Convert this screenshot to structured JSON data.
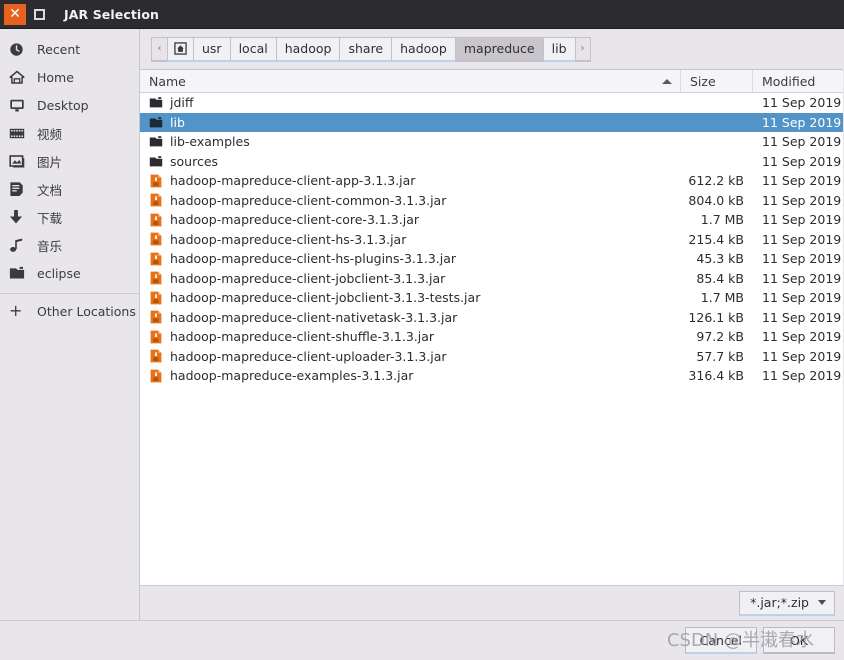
{
  "window": {
    "title": "JAR Selection",
    "close_label": "✕",
    "maximize_label": ""
  },
  "sidebar": {
    "items": [
      {
        "label": "Recent",
        "icon": "clock-icon"
      },
      {
        "label": "Home",
        "icon": "home-icon"
      },
      {
        "label": "Desktop",
        "icon": "desktop-icon"
      },
      {
        "label": "视频",
        "icon": "video-icon"
      },
      {
        "label": "图片",
        "icon": "pictures-icon"
      },
      {
        "label": "文档",
        "icon": "documents-icon"
      },
      {
        "label": "下载",
        "icon": "downloads-icon"
      },
      {
        "label": "音乐",
        "icon": "music-icon"
      },
      {
        "label": "eclipse",
        "icon": "folder-icon"
      }
    ],
    "other_locations": {
      "label": "Other Locations",
      "icon": "plus-icon"
    }
  },
  "pathbar": {
    "prev_label": "‹",
    "next_label": "›",
    "crumbs": [
      {
        "label": "",
        "icon": "home-crumb-icon",
        "active": false
      },
      {
        "label": "usr",
        "active": false
      },
      {
        "label": "local",
        "active": false
      },
      {
        "label": "hadoop",
        "active": false
      },
      {
        "label": "share",
        "active": false
      },
      {
        "label": "hadoop",
        "active": false
      },
      {
        "label": "mapreduce",
        "active": true
      },
      {
        "label": "lib",
        "active": false
      }
    ]
  },
  "filelist": {
    "columns": {
      "name": "Name",
      "size": "Size",
      "modified": "Modified"
    },
    "sort": {
      "column": "Name",
      "direction": "asc"
    },
    "rows": [
      {
        "name": "jdiff",
        "type": "folder",
        "size": "",
        "modified": "11 Sep 2019",
        "selected": false
      },
      {
        "name": "lib",
        "type": "folder",
        "size": "",
        "modified": "11 Sep 2019",
        "selected": true
      },
      {
        "name": "lib-examples",
        "type": "folder",
        "size": "",
        "modified": "11 Sep 2019",
        "selected": false
      },
      {
        "name": "sources",
        "type": "folder",
        "size": "",
        "modified": "11 Sep 2019",
        "selected": false
      },
      {
        "name": "hadoop-mapreduce-client-app-3.1.3.jar",
        "type": "jar",
        "size": "612.2 kB",
        "modified": "11 Sep 2019",
        "selected": false
      },
      {
        "name": "hadoop-mapreduce-client-common-3.1.3.jar",
        "type": "jar",
        "size": "804.0 kB",
        "modified": "11 Sep 2019",
        "selected": false
      },
      {
        "name": "hadoop-mapreduce-client-core-3.1.3.jar",
        "type": "jar",
        "size": "1.7 MB",
        "modified": "11 Sep 2019",
        "selected": false
      },
      {
        "name": "hadoop-mapreduce-client-hs-3.1.3.jar",
        "type": "jar",
        "size": "215.4 kB",
        "modified": "11 Sep 2019",
        "selected": false
      },
      {
        "name": "hadoop-mapreduce-client-hs-plugins-3.1.3.jar",
        "type": "jar",
        "size": "45.3 kB",
        "modified": "11 Sep 2019",
        "selected": false
      },
      {
        "name": "hadoop-mapreduce-client-jobclient-3.1.3.jar",
        "type": "jar",
        "size": "85.4 kB",
        "modified": "11 Sep 2019",
        "selected": false
      },
      {
        "name": "hadoop-mapreduce-client-jobclient-3.1.3-tests.jar",
        "type": "jar",
        "size": "1.7 MB",
        "modified": "11 Sep 2019",
        "selected": false
      },
      {
        "name": "hadoop-mapreduce-client-nativetask-3.1.3.jar",
        "type": "jar",
        "size": "126.1 kB",
        "modified": "11 Sep 2019",
        "selected": false
      },
      {
        "name": "hadoop-mapreduce-client-shuffle-3.1.3.jar",
        "type": "jar",
        "size": "97.2 kB",
        "modified": "11 Sep 2019",
        "selected": false
      },
      {
        "name": "hadoop-mapreduce-client-uploader-3.1.3.jar",
        "type": "jar",
        "size": "57.7 kB",
        "modified": "11 Sep 2019",
        "selected": false
      },
      {
        "name": "hadoop-mapreduce-examples-3.1.3.jar",
        "type": "jar",
        "size": "316.4 kB",
        "modified": "11 Sep 2019",
        "selected": false
      }
    ]
  },
  "filter": {
    "value": "*.jar;*.zip"
  },
  "buttons": {
    "cancel": "Cancel",
    "ok": "OK"
  },
  "watermark": {
    "text": "CSDN @半溨春水"
  },
  "colors": {
    "titlebar_bg": "#2c2c30",
    "close_button": "#e8621f",
    "selection_blue": "#5294c8",
    "jar_icon_orange": "#e8711a",
    "chrome_bg": "#e8e6eb",
    "list_bg": "#ffffff"
  }
}
